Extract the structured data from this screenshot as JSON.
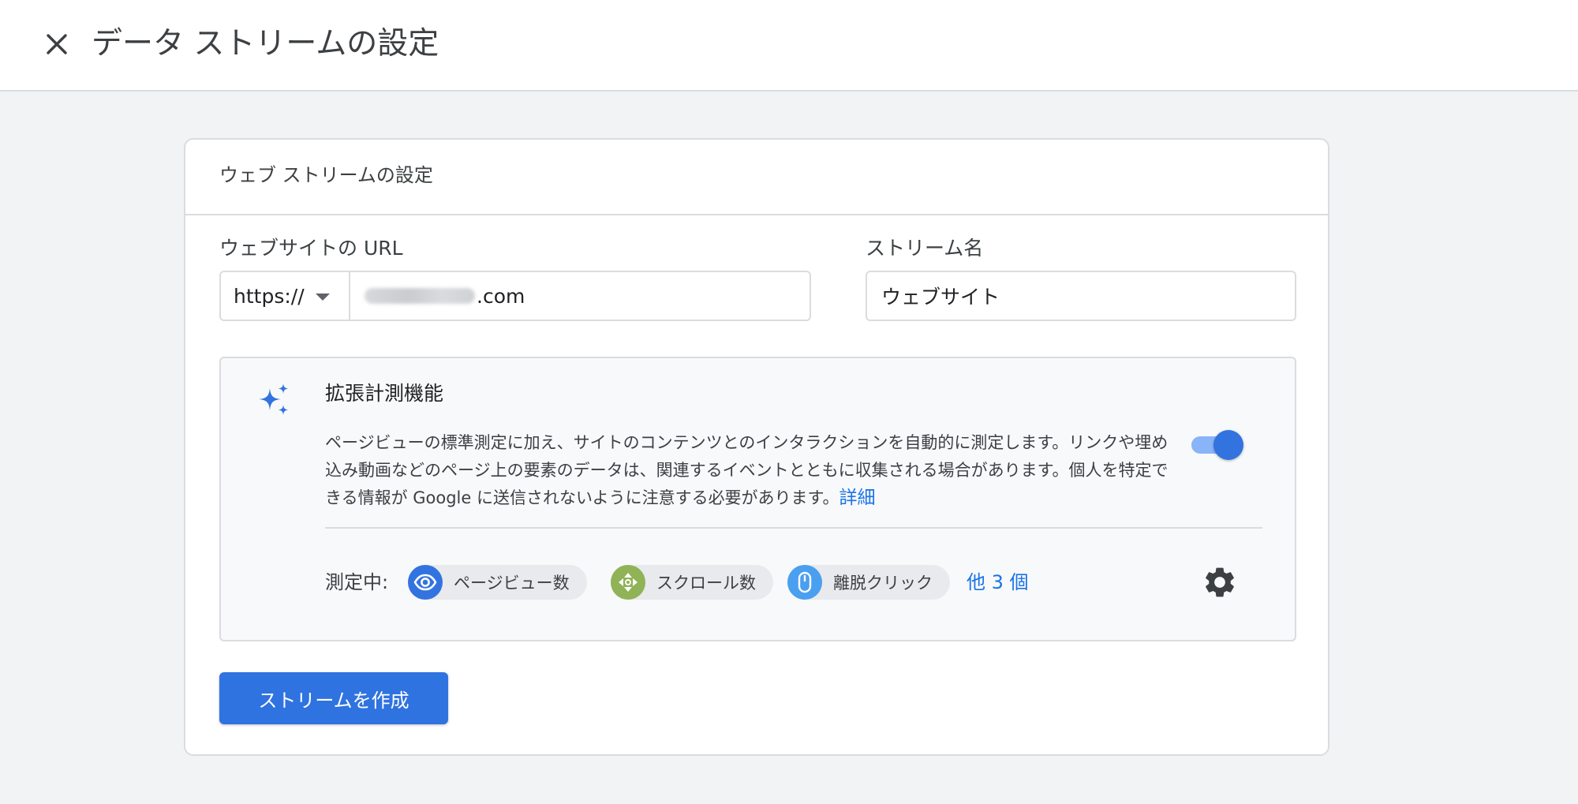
{
  "header": {
    "title": "データ ストリームの設定",
    "close_icon": "close-icon"
  },
  "card": {
    "title": "ウェブ ストリームの設定",
    "url_field": {
      "label": "ウェブサイトの URL",
      "protocol": "https://",
      "value_suffix": ".com"
    },
    "name_field": {
      "label": "ストリーム名",
      "value": "ウェブサイト"
    },
    "enhanced": {
      "icon": "sparkle-icon",
      "title": "拡張計測機能",
      "description": "ページビューの標準測定に加え、サイトのコンテンツとのインタラクションを自動的に測定します。リンクや埋め込み動画などのページ上の要素のデータは、関連するイベントとともに収集される場合があります。個人を特定できる情報が Google に送信されないように注意する必要があります。",
      "learn_more": "詳細",
      "enabled": true,
      "measuring_label": "測定中:",
      "chips": [
        {
          "label": "ページビュー数",
          "icon": "eye-icon",
          "color": "#3273e0"
        },
        {
          "label": "スクロール数",
          "icon": "scroll-arrows-icon",
          "color": "#8fb356"
        },
        {
          "label": "離脱クリック",
          "icon": "mouse-icon",
          "color": "#4a9ff0"
        }
      ],
      "more": "他 3 個",
      "settings_icon": "gear-icon"
    },
    "create_button": "ストリームを作成"
  },
  "colors": {
    "accent": "#2f73e0",
    "background": "#f1f3f4",
    "link": "#1a73e8"
  }
}
